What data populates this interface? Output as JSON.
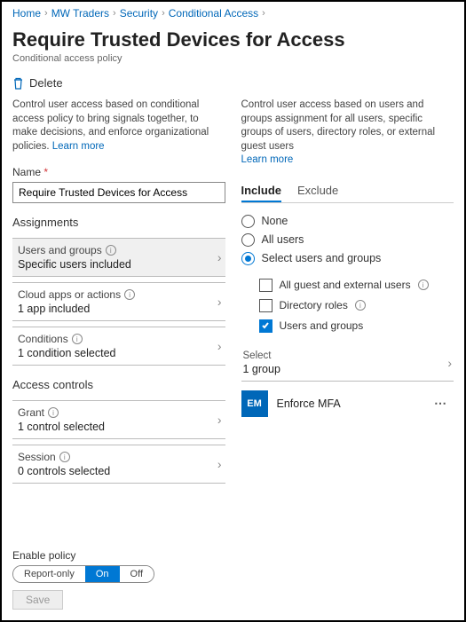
{
  "breadcrumb": [
    {
      "label": "Home"
    },
    {
      "label": "MW Traders"
    },
    {
      "label": "Security"
    },
    {
      "label": "Conditional Access"
    }
  ],
  "title": "Require Trusted Devices for Access",
  "subtitle": "Conditional access policy",
  "delete_label": "Delete",
  "left": {
    "desc": "Control user access based on conditional access policy to bring signals together, to make decisions, and enforce organizational policies.",
    "learn_more": "Learn more",
    "name_label": "Name",
    "name_value": "Require Trusted Devices for Access",
    "assignments_head": "Assignments",
    "items": [
      {
        "title": "Users and groups",
        "sub": "Specific users included",
        "selected": true
      },
      {
        "title": "Cloud apps or actions",
        "sub": "1 app included",
        "selected": false
      },
      {
        "title": "Conditions",
        "sub": "1 condition selected",
        "selected": false
      }
    ],
    "access_head": "Access controls",
    "access_items": [
      {
        "title": "Grant",
        "sub": "1 control selected"
      },
      {
        "title": "Session",
        "sub": "0 controls selected"
      }
    ]
  },
  "right": {
    "desc": "Control user access based on users and groups assignment for all users, specific groups of users, directory roles, or external guest users",
    "learn_more": "Learn more",
    "tabs": [
      "Include",
      "Exclude"
    ],
    "active_tab": 0,
    "radios": [
      "None",
      "All users",
      "Select users and groups"
    ],
    "radio_selected": 2,
    "checks": [
      {
        "label": "All guest and external users",
        "checked": false,
        "info": true
      },
      {
        "label": "Directory roles",
        "checked": false,
        "info": true
      },
      {
        "label": "Users and groups",
        "checked": true,
        "info": false
      }
    ],
    "select_label": "Select",
    "select_value": "1 group",
    "group_badge": "EM",
    "group_name": "Enforce MFA"
  },
  "footer": {
    "label": "Enable policy",
    "options": [
      "Report-only",
      "On",
      "Off"
    ],
    "active": 1,
    "save": "Save"
  }
}
